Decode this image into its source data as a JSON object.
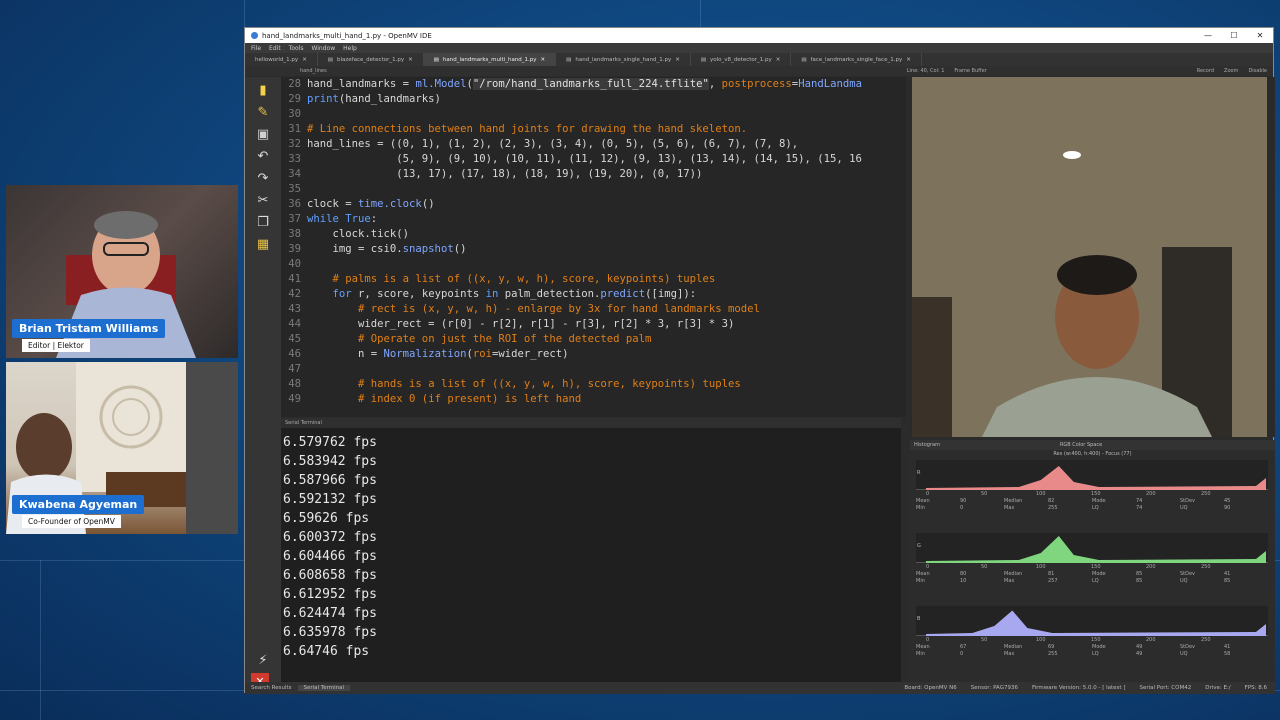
{
  "window": {
    "title": "hand_landmarks_multi_hand_1.py - OpenMV IDE",
    "controls": [
      "—",
      "☐",
      "✕"
    ]
  },
  "menu": [
    "File",
    "Edit",
    "Tools",
    "Window",
    "Help"
  ],
  "tabs": [
    {
      "label": "helloworld_1.py",
      "active": false
    },
    {
      "label": "blazeface_detector_1.py",
      "active": false
    },
    {
      "label": "hand_landmarks_multi_hand_1.py",
      "active": true
    },
    {
      "label": "hand_landmarks_single_hand_1.py",
      "active": false
    },
    {
      "label": "yolo_v8_detector_1.py",
      "active": false
    },
    {
      "label": "face_landmarks_single_face_1.py",
      "active": false
    }
  ],
  "subbar": {
    "left": "hand_lines",
    "position": "Line: 40, Col: 1",
    "frame_buffer": "Frame Buffer",
    "record": "Record",
    "zoom": "Zoom",
    "disable": "Disable"
  },
  "code_lines": [
    {
      "n": "28",
      "html": "hand_landmarks = <span class='md'>ml.Model</span>(<span class='st'>\"/rom/hand_landmarks_full_224.tflite\"</span>, <span class='pp'>postprocess</span>=<span class='md'>HandLandma</span>"
    },
    {
      "n": "29",
      "html": "<span class='kw'>print</span>(hand_landmarks)"
    },
    {
      "n": "30",
      "html": ""
    },
    {
      "n": "31",
      "html": "<span class='cm'># Line connections between hand joints for drawing the hand skeleton.</span>"
    },
    {
      "n": "32",
      "html": "hand_lines = ((0, 1), (1, 2), (2, 3), (3, 4), (0, 5), (5, 6), (6, 7), (7, 8),"
    },
    {
      "n": "33",
      "html": "              (5, 9), (9, 10), (10, 11), (11, 12), (9, 13), (13, 14), (14, 15), (15, 16"
    },
    {
      "n": "34",
      "html": "              (13, 17), (17, 18), (18, 19), (19, 20), (0, 17))"
    },
    {
      "n": "35",
      "html": ""
    },
    {
      "n": "36",
      "html": "clock = <span class='md'>time.clock</span>()"
    },
    {
      "n": "37",
      "html": "<span class='kw'>while</span> <span class='kw'>True</span>:"
    },
    {
      "n": "38",
      "html": "    clock.tick()"
    },
    {
      "n": "39",
      "html": "    img = csi0.<span class='md'>snapshot</span>()"
    },
    {
      "n": "40",
      "html": ""
    },
    {
      "n": "41",
      "html": "    <span class='cm'># palms is a list of ((x, y, w, h), score, keypoints) tuples</span>"
    },
    {
      "n": "42",
      "html": "    <span class='kw'>for</span> r, score, keypoints <span class='kw'>in</span> palm_detection.<span class='md'>predict</span>([img]):"
    },
    {
      "n": "43",
      "html": "        <span class='cm'># rect is (x, y, w, h) - enlarge by 3x for hand landmarks model</span>"
    },
    {
      "n": "44",
      "html": "        wider_rect = (r[0] - r[2], r[1] - r[3], r[2] * 3, r[3] * 3)"
    },
    {
      "n": "45",
      "html": "        <span class='cm'># Operate on just the ROI of the detected palm</span>"
    },
    {
      "n": "46",
      "html": "        n = <span class='md'>Normalization</span>(<span class='pp'>roi</span>=wider_rect)"
    },
    {
      "n": "47",
      "html": ""
    },
    {
      "n": "48",
      "html": "        <span class='cm'># hands is a list of ((x, y, w, h), score, keypoints) tuples</span>"
    },
    {
      "n": "49",
      "html": "        <span class='cm'># index 0 (if present) is left hand</span>"
    }
  ],
  "terminal": {
    "header": "Serial Terminal",
    "lines": [
      "6.579762 fps",
      "6.583942 fps",
      "6.587966 fps",
      "6.592132 fps",
      "6.59626 fps",
      "6.600372 fps",
      "6.604466 fps",
      "6.608658 fps",
      "6.612952 fps",
      "6.624474 fps",
      "6.635978 fps",
      "6.64746 fps"
    ]
  },
  "bottom": {
    "tabs": [
      "Search Results",
      "Serial Terminal"
    ],
    "status": [
      "Board: OpenMV N6",
      "Sensor: PAG7936",
      "Firmware Version: 5.0.0 - [ latest ]",
      "Serial Port: COM42",
      "Drive: E:/",
      "FPS: 8.6"
    ]
  },
  "histogram": {
    "title": "Histogram",
    "colorspace": "RGB Color Space",
    "res": "Res (w:400, h:400) - Focus (77)",
    "axis": [
      "0",
      "50",
      "100",
      "150",
      "200",
      "250"
    ],
    "channels": [
      {
        "label": "R",
        "color": "#e88a8a",
        "stats": [
          "Mean",
          "90",
          "Median",
          "82",
          "Mode",
          "74",
          "StDev",
          "45"
        ],
        "stats2": [
          "Min",
          "0",
          "Max",
          "255",
          "LQ",
          "74",
          "UQ",
          "90"
        ]
      },
      {
        "label": "G",
        "color": "#7fd67f",
        "stats": [
          "Mean",
          "80",
          "Median",
          "81",
          "Mode",
          "85",
          "StDev",
          "41"
        ],
        "stats2": [
          "Min",
          "10",
          "Max",
          "257",
          "LQ",
          "85",
          "UQ",
          "85"
        ]
      },
      {
        "label": "B",
        "color": "#a8a8f0",
        "stats": [
          "Mean",
          "67",
          "Median",
          "69",
          "Mode",
          "49",
          "StDev",
          "41"
        ],
        "stats2": [
          "Min",
          "0",
          "Max",
          "255",
          "LQ",
          "49",
          "UQ",
          "58"
        ]
      }
    ]
  },
  "participants": [
    {
      "name": "Brian Tristam Williams",
      "role": "Editor | Elektor"
    },
    {
      "name": "Kwabena Agyeman",
      "role": "Co-Founder of OpenMV"
    }
  ]
}
